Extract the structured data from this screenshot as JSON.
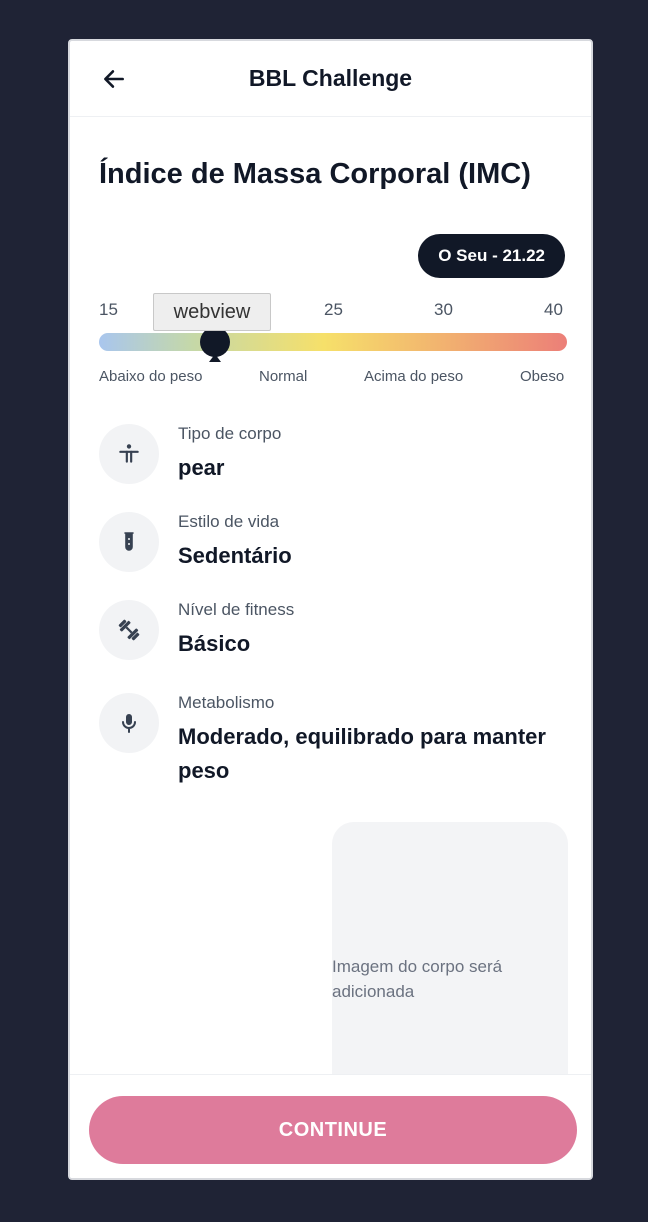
{
  "header": {
    "title": "BBL Challenge"
  },
  "page_title": "Índice de Massa Corporal (IMC)",
  "bmi": {
    "badge": "O Seu - 21.22",
    "value": 21.22,
    "tooltip": "webview",
    "scale_numbers": [
      "15",
      "25",
      "30",
      "40"
    ],
    "categories": [
      "Abaixo do peso",
      "Normal",
      "Acima do peso",
      "Obeso"
    ],
    "gradient_colors": [
      "#a9c6ee",
      "#c5d8a8",
      "#f6e06a",
      "#f2b56f",
      "#ec7f78"
    ]
  },
  "attributes": [
    {
      "label": "Tipo de corpo",
      "value": "pear",
      "icon": "body-type-icon"
    },
    {
      "label": "Estilo de vida",
      "value": "Sedentário",
      "icon": "test-tube-icon"
    },
    {
      "label": "Nível de fitness",
      "value": "Básico",
      "icon": "dumbbell-icon"
    },
    {
      "label": "Metabolismo",
      "value": "Moderado, equilibrado para manter peso",
      "icon": "microphone-icon"
    }
  ],
  "body_image": {
    "placeholder": "Imagem do corpo será adicionada"
  },
  "footer": {
    "button_label": "CONTINUE",
    "button_color": "#de7b9b"
  },
  "colors": {
    "background": "#1f2335",
    "dark": "#111827",
    "muted": "#4b5563"
  }
}
